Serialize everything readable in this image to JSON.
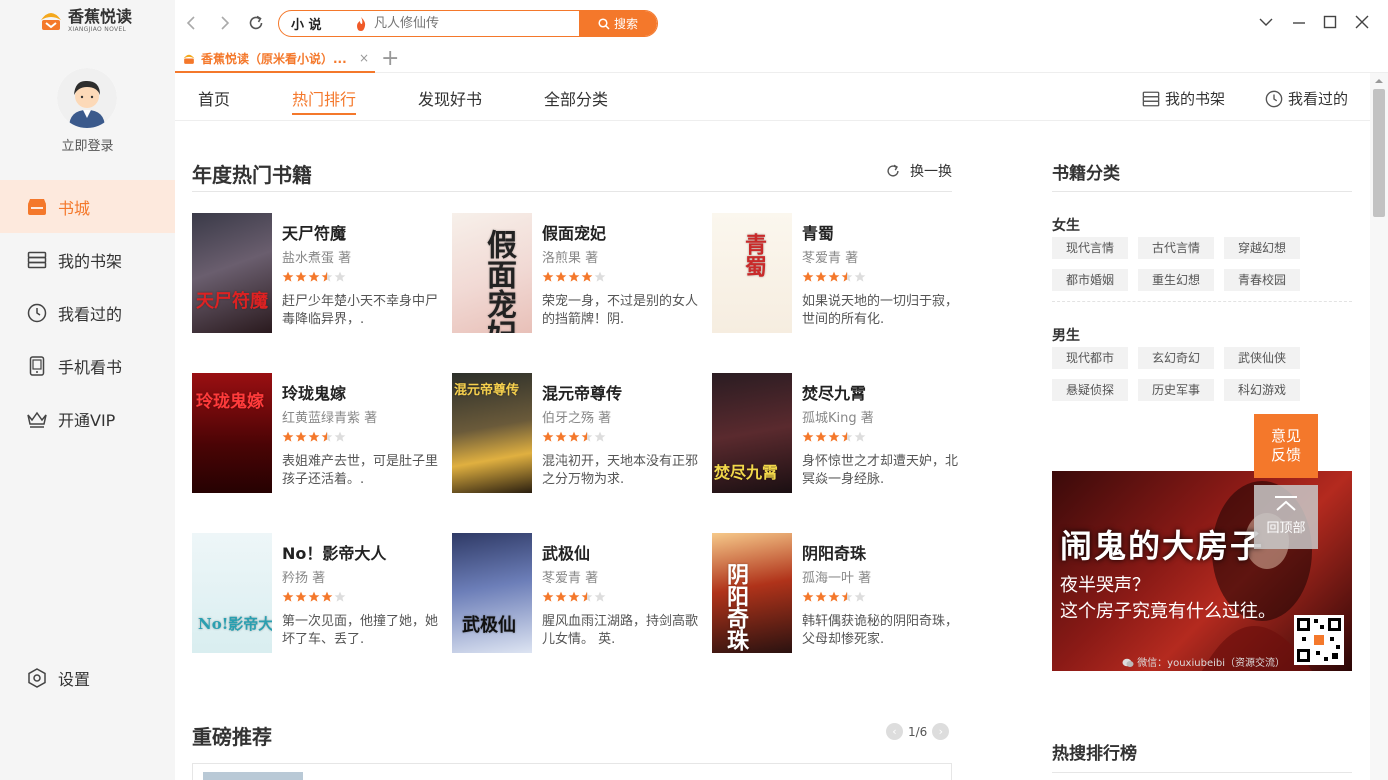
{
  "app": {
    "logo_cn": "香蕉悦读",
    "logo_en": "XIANGJIAO NOVEL"
  },
  "sidebar": {
    "login": "立即登录",
    "items": [
      {
        "label": "书城",
        "icon": "store-icon",
        "active": true
      },
      {
        "label": "我的书架",
        "icon": "bookshelf-icon",
        "active": false
      },
      {
        "label": "我看过的",
        "icon": "clock-icon",
        "active": false
      },
      {
        "label": "手机看书",
        "icon": "phone-icon",
        "active": false
      },
      {
        "label": "开通VIP",
        "icon": "crown-icon",
        "active": false
      }
    ],
    "settings": "设置"
  },
  "search": {
    "category": "小 说",
    "placeholder": "凡人修仙传",
    "button": "搜索"
  },
  "tab": {
    "title": "香蕉悦读（原米看小说）...",
    "close": "×",
    "add": "+"
  },
  "topnav": {
    "items": [
      "首页",
      "热门排行",
      "发现好书",
      "全部分类"
    ],
    "active": "热门排行",
    "shelf": "我的书架",
    "history": "我看过的"
  },
  "hot_books": {
    "title": "年度热门书籍",
    "refresh": "换一换",
    "books": [
      {
        "title": "天尸符魔",
        "author": "盐水煮蛋 著",
        "rating": 3.5,
        "desc": "赶尸少年楚小天不幸身中尸毒降临异界，.",
        "cover_text": "天尸符魔"
      },
      {
        "title": "假面宠妃",
        "author": "洛煎果 著",
        "rating": 4,
        "desc": "荣宠一身，不过是别的女人的挡箭牌！阴.",
        "cover_text": "假面宠妃"
      },
      {
        "title": "青蜀",
        "author": "苳爱青 著",
        "rating": 3.5,
        "desc": "如果说天地的一切归于寂，世间的所有化.",
        "cover_text": "青蜀"
      },
      {
        "title": "玲珑鬼嫁",
        "author": "红黄蓝绿青紫 著",
        "rating": 3.5,
        "desc": "表姐难产去世，可是肚子里孩子还活着。.",
        "cover_text": "玲珑鬼嫁"
      },
      {
        "title": "混元帝尊传",
        "author": "伯牙之殇 著",
        "rating": 3.5,
        "desc": "混沌初开，天地本没有正邪之分万物为求.",
        "cover_text": "混元帝尊传"
      },
      {
        "title": "焚尽九霄",
        "author": "孤城King 著",
        "rating": 3.5,
        "desc": "身怀惊世之才却遭天妒，北冥焱一身经脉.",
        "cover_text": "焚尽九霄"
      },
      {
        "title": "No！影帝大人",
        "author": "矜扬 著",
        "rating": 4,
        "desc": "第一次见面，他撞了她，她坏了车、丢了.",
        "cover_text": "No!影帝大人"
      },
      {
        "title": "武极仙",
        "author": "苳爱青 著",
        "rating": 3.5,
        "desc": "腥风血雨江湖路，持剑高歌儿女情。 英.",
        "cover_text": "武极仙"
      },
      {
        "title": "阴阳奇珠",
        "author": "孤海一叶 著",
        "rating": 3.5,
        "desc": "韩轩偶获诡秘的阴阳奇珠，父母却惨死家.",
        "cover_text": "阴阳奇珠"
      }
    ]
  },
  "featured": {
    "title": "重磅推荐",
    "page": "1/6"
  },
  "categories": {
    "title": "书籍分类",
    "female_label": "女生",
    "female": [
      "现代言情",
      "古代言情",
      "穿越幻想",
      "都市婚姻",
      "重生幻想",
      "青春校园"
    ],
    "male_label": "男生",
    "male": [
      "现代都市",
      "玄幻奇幻",
      "武侠仙侠",
      "悬疑侦探",
      "历史军事",
      "科幻游戏"
    ]
  },
  "ad": {
    "headline": "闹鬼的大房子",
    "line1": "夜半哭声？",
    "line2": "这个房子究竟有什么过往。",
    "footer": "微信：youxiubeibi（资源交流）"
  },
  "float": {
    "feedback": "意见反馈",
    "top": "回顶部"
  },
  "hot_search": {
    "title": "热搜排行榜"
  },
  "colors": {
    "accent": "#f4782b",
    "star": "#f4782b"
  }
}
